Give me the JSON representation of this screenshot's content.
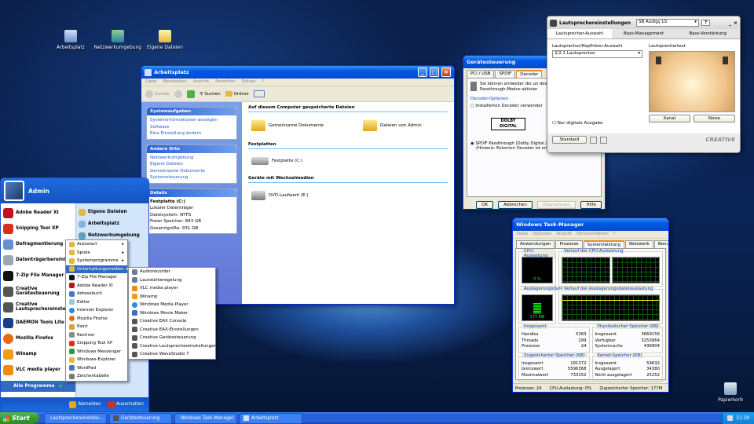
{
  "desktop": {
    "icons": [
      "Arbeitsplatz",
      "Netzwerkumgebung",
      "Eigene Dateien",
      "Papierkorb"
    ]
  },
  "explorer": {
    "title": "Arbeitsplatz",
    "menu": [
      "Datei",
      "Bearbeiten",
      "Ansicht",
      "Favoriten",
      "Extras",
      "?"
    ],
    "toolbar": {
      "back": "Zurück",
      "search": "Suchen",
      "folders": "Ordner"
    },
    "tasks_title": "Systemaufgaben",
    "tasks": [
      "Systeminformationen anzeigen",
      "Software",
      "Eine Einstellung ändern"
    ],
    "other_title": "Andere Orte",
    "other": [
      "Netzwerkumgebung",
      "Eigene Dateien",
      "Gemeinsame Dokumente",
      "Systemsteuerung"
    ],
    "details_title": "Details",
    "details": {
      "name": "Festplatte (C:)",
      "type": "Lokaler Datenträger",
      "fs": "Dateisystem: NTFS",
      "free": "Freier Speicher: 843 GB",
      "total": "Gesamtgröße: 931 GB"
    },
    "sec1": "Auf diesem Computer gespeicherte Dateien",
    "shared": "Gemeinsame Dokumente",
    "admin_files": "Dateien von Admin",
    "sec2": "Festplatten",
    "drive_c": "Festplatte (C:)",
    "sec3": "Geräte mit Wechselmedien",
    "dvd": "DVD-Laufwerk (E:)"
  },
  "device": {
    "title": "Gerätesteuerung",
    "tabs": [
      "PCI / USB",
      "SPDIF",
      "Decoder"
    ],
    "desc": "Sie können entweder die un des Decoders einstellungen Passthrough-Modus aktivier",
    "group": "Decoder-Optionen",
    "opt1": "Installierten Decoder verwender",
    "dolby": "DOLBY DIGITAL",
    "opt2": "SPDIF Passthrough (Dolby Digital / DTS Digital Out)",
    "hint": "(Hinweis: Externen Decoder ist erforderlich.)",
    "buttons": [
      "OK",
      "Abbrechen",
      "Übernehmen",
      "Hilfe"
    ]
  },
  "speaker": {
    "title": "Lautsprechereinstellungen",
    "device": "SB Audigy LS",
    "tabs": [
      "Lautsprecher-Auswahl",
      "Bass-Management",
      "Bass-Verstärkung"
    ],
    "sel_label": "Lautsprecher/Kopfhörer-Auswahl",
    "sel_value": "2/2.1 Lautsprecher",
    "digital": "Nur digitale Ausgabe",
    "test_label": "Lautsprechertest",
    "channel": "Kanal",
    "noise": "Noise",
    "standard": "Standard",
    "brand": "CREATIVE"
  },
  "taskmgr": {
    "title": "Windows Task-Manager",
    "menu": [
      "Datei",
      "Optionen",
      "Ansicht",
      "Herunterfahren",
      "?"
    ],
    "tabs": [
      "Anwendungen",
      "Prozesse",
      "Systemleistung",
      "Netzwerk",
      "Benutzer"
    ],
    "cpu_label": "CPU-Auslastung",
    "cpu_value": "0 %",
    "cpu_hist": "Verlauf der CPU-Auslastung",
    "pf_label": "Auslagerungsdatei",
    "pf_value": "177 MB",
    "pf_hist": "Verlauf der Auslagerungsdateiauslastung",
    "totals": {
      "title": "Insgesamt",
      "rows": [
        [
          "Handles",
          "5383"
        ],
        [
          "Threads",
          "299"
        ],
        [
          "Prozesse",
          "24"
        ]
      ]
    },
    "phys": {
      "title": "Physikalischer Speicher (KB)",
      "rows": [
        [
          "Insgesamt",
          "3669156"
        ],
        [
          "Verfügbar",
          "3253864"
        ],
        [
          "Systemcache",
          "436804"
        ]
      ]
    },
    "commit": {
      "title": "Zugesicherter Speicher (KB)",
      "rows": [
        [
          "Insgesamt",
          "181372"
        ],
        [
          "Grenzwert",
          "5596368"
        ],
        [
          "Maximalwert",
          "733152"
        ]
      ]
    },
    "kernel": {
      "title": "Kernel-Speicher (KB)",
      "rows": [
        [
          "Insgesamt",
          "59632"
        ],
        [
          "Ausgelagert",
          "34380"
        ],
        [
          "Nicht ausgelagert",
          "25252"
        ]
      ]
    },
    "status": [
      "Prozesse: 24",
      "CPU-Auslastung: 0%",
      "Zugesicherter Speicher: 177M"
    ]
  },
  "startmenu": {
    "user": "Admin",
    "pinned": [
      "Adobe Reader XI",
      "Snipping Tool XP",
      "Defragmentierung",
      "Datenträgerbereinigung",
      "7-Zip File Manager",
      "Creative Gerätesteuerung",
      "Creative Lautsprechereinstellu...",
      "DAEMON Tools Lite",
      "Mozilla Firefox",
      "Winamp",
      "VLC media player"
    ],
    "places": [
      "Eigene Dateien",
      "Arbeitsplatz",
      "Netzwerkumgebung"
    ],
    "all_programs": "Alle Programme",
    "logoff": "Abmelden",
    "shutdown": "Ausschalten"
  },
  "programs": [
    "Autostart",
    "Spiele",
    "Systemprogramme",
    "Unterhaltungsmedien",
    "7-Zip File Manager",
    "Adobe Reader XI",
    "Adressbuch",
    "Editor",
    "Internet Explorer",
    "Mozilla Firefox",
    "Paint",
    "Rechner",
    "Snipping Tool XP",
    "Windows Messenger",
    "Windows-Explorer",
    "WordPad",
    "Zeichentabelle"
  ],
  "media": [
    "Audiorecorder",
    "Lautstärkeregelung",
    "VLC media player",
    "Winamp",
    "Windows Media Player",
    "Windows Movie Maker",
    "Creative EAX Console",
    "Creative EAX-Einstellungen",
    "Creative Gerätesteuerung",
    "Creative Lautsprechereinstellungen",
    "Creative WaveStudio 7"
  ],
  "taskbar": {
    "start": "Start",
    "tasks": [
      "Lautsprechereinstellu...",
      "Gerätesteuerung",
      "Windows Task-Manager",
      "Arbeitsplatz"
    ],
    "clock": "21:28"
  }
}
